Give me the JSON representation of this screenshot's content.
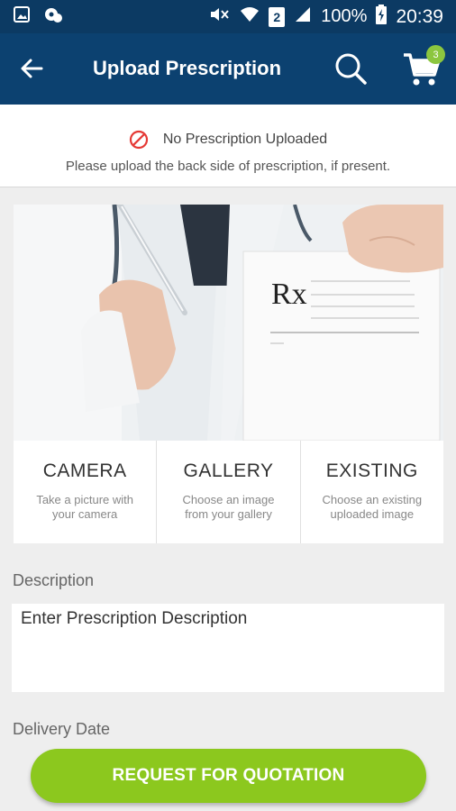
{
  "status_bar": {
    "battery": "100%",
    "time": "20:39",
    "sim_number": "2"
  },
  "app_bar": {
    "title": "Upload Prescription",
    "cart_count": "3"
  },
  "banner": {
    "status": "No Prescription Uploaded",
    "hint": "Please upload the back side of prescription, if present."
  },
  "photo": {
    "rx_text": "Rx"
  },
  "options": [
    {
      "title": "CAMERA",
      "desc": "Take a picture with your camera"
    },
    {
      "title": "GALLERY",
      "desc": "Choose an image from your gallery"
    },
    {
      "title": "EXISTING",
      "desc": "Choose an existing uploaded image"
    }
  ],
  "description": {
    "label": "Description",
    "placeholder": "Enter Prescription Description"
  },
  "delivery": {
    "label": "Delivery Date"
  },
  "request_button": {
    "label": "REQUEST FOR QUOTATION"
  },
  "colors": {
    "app_bar": "#0c4170",
    "status_bar": "#0c3a63",
    "accent_green": "#8cc81e",
    "error_red": "#e53935"
  }
}
